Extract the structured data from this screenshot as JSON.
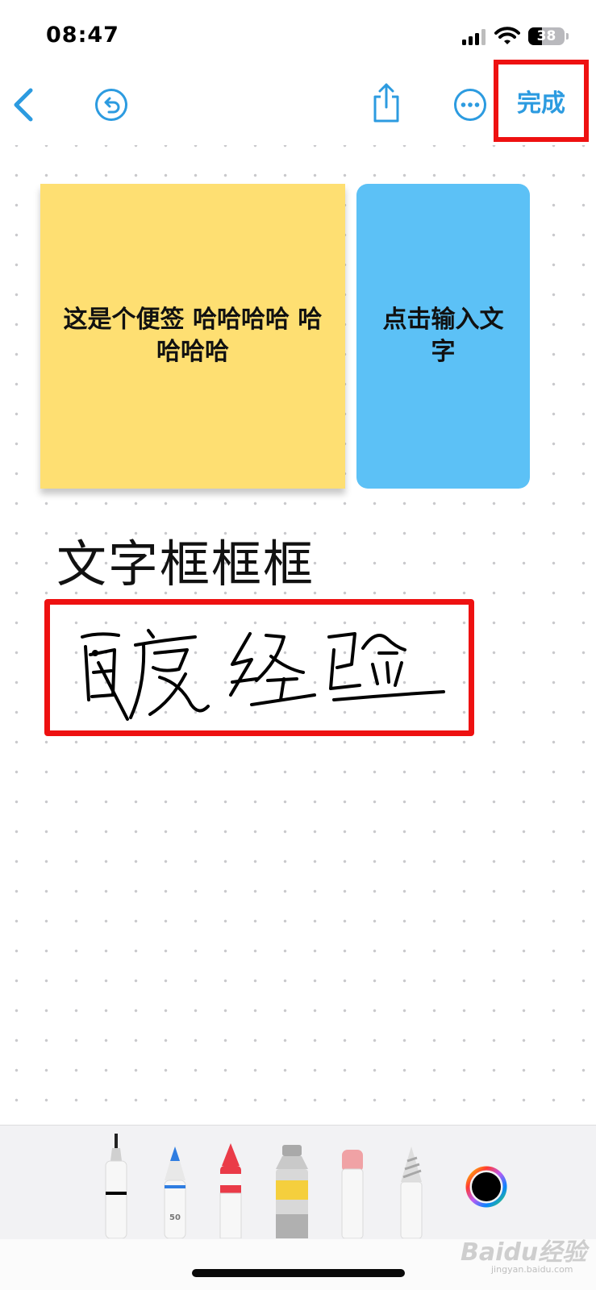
{
  "status_bar": {
    "time": "08:47",
    "battery_level": "38",
    "battery_fraction": 0.38
  },
  "toolbar": {
    "back_icon": "chevron-left-icon",
    "undo_icon": "undo-icon",
    "share_icon": "share-icon",
    "more_icon": "ellipsis-icon",
    "done_label": "完成",
    "accent_color": "#2c9be0"
  },
  "canvas": {
    "sticky_notes": [
      {
        "text": "这是个便签 哈哈哈哈 哈哈哈哈",
        "color": "#fedf72"
      },
      {
        "text": "点击输入文字",
        "color": "#5cc1f6"
      }
    ],
    "text_box": "文字框框框",
    "handwriting_text": "百度经验",
    "highlight_color": "#ee1111"
  },
  "tools": {
    "items": [
      {
        "name": "fineliner-pen",
        "selected": false
      },
      {
        "name": "monoline-pen",
        "selected": false,
        "width_label": "50",
        "color": "#2f7de1"
      },
      {
        "name": "crayon",
        "selected": false,
        "color": "#ea3b48"
      },
      {
        "name": "paint-tube",
        "selected": false,
        "color": "#f5cf3d"
      },
      {
        "name": "eraser",
        "selected": false
      },
      {
        "name": "pencil",
        "selected": false
      }
    ],
    "current_color": "#000000"
  },
  "watermark": {
    "logo": "Baidu经验",
    "url": "jingyan.baidu.com"
  }
}
